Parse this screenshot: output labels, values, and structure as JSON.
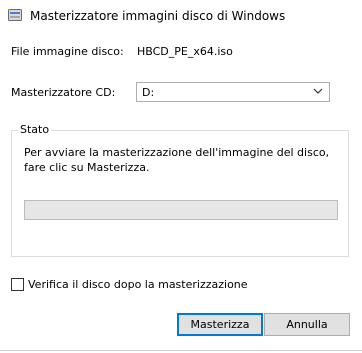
{
  "window": {
    "title": "Masterizzatore immagini disco di Windows",
    "icon": "disc-burner-icon"
  },
  "fields": {
    "file_label": "File immagine disco:",
    "file_value": "HBCD_PE_x64.iso",
    "burner_label": "Masterizzatore CD:",
    "burner_value": "D:"
  },
  "status": {
    "group_title": "Stato",
    "message": "Per avviare la masterizzazione dell'immagine del disco, fare clic su Masterizza.",
    "progress": 0
  },
  "verify": {
    "label": "Verifica il disco dopo la masterizzazione",
    "checked": false
  },
  "buttons": {
    "burn": "Masterizza",
    "cancel": "Annulla"
  },
  "colors": {
    "accent": "#0078d7",
    "progress_fill": "#06b025"
  }
}
